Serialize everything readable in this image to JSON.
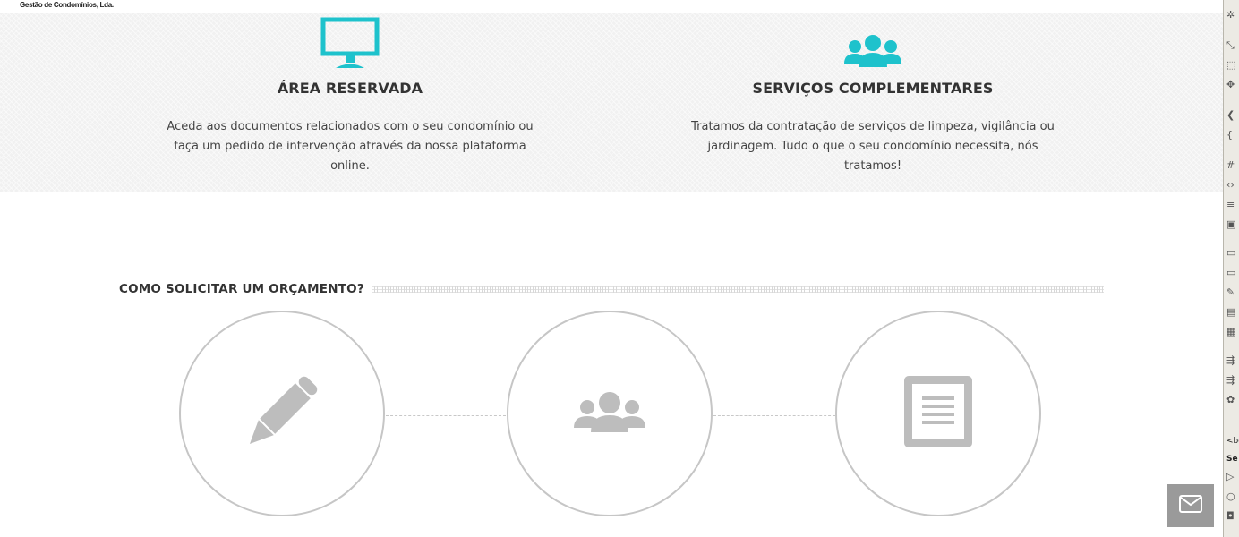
{
  "header": {
    "logo_text": "Gestão de Condomínios, Lda."
  },
  "features": [
    {
      "icon": "monitor-icon",
      "title": "ÁREA RESERVADA",
      "line1": "Aceda aos documentos relacionados com o seu condomínio ou",
      "line2": "faça um pedido de intervenção através da nossa plataforma online."
    },
    {
      "icon": "people-group-icon",
      "title": "SERVIÇOS COMPLEMENTARES",
      "line1": "Tratamos da contratação de serviços de limpeza, vigilância ou",
      "line2": "jardinagem. Tudo o que o seu condomínio necessita, nós tratamos!"
    }
  ],
  "how_to": {
    "title": "COMO SOLICITAR UM ORÇAMENTO?",
    "steps": [
      {
        "icon": "pencil-icon"
      },
      {
        "icon": "people-group-icon"
      },
      {
        "icon": "document-icon"
      }
    ]
  },
  "side_strip": {
    "tag_label": "<bo",
    "panel_label": "Se"
  },
  "contact_button": {
    "icon": "envelope-icon"
  },
  "colors": {
    "accent": "#1ec2cc",
    "step_icon": "#bdbdbd",
    "band_bg": "#f1f1f1",
    "contact_bg": "#9a9a9a"
  }
}
